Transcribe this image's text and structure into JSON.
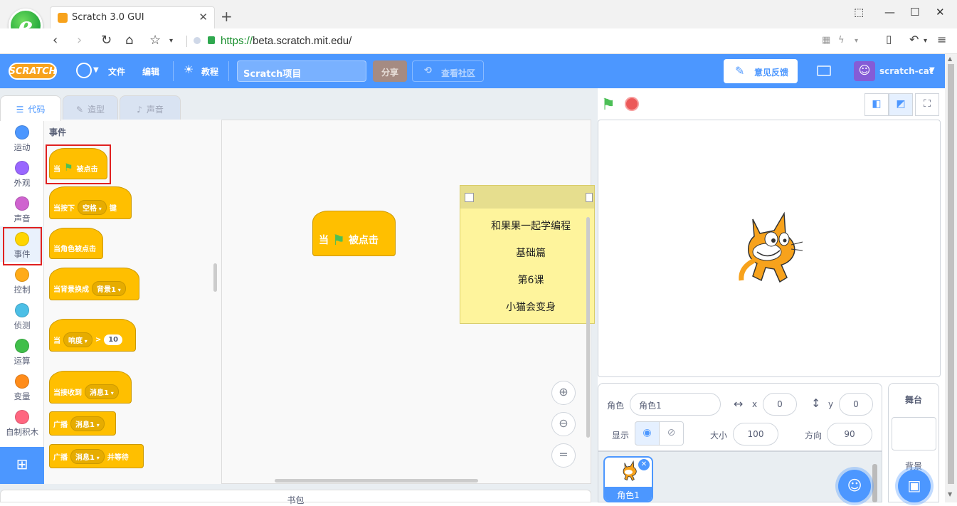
{
  "browser": {
    "tab_title": "Scratch 3.0 GUI",
    "tab_close": "✕",
    "new_tab": "+",
    "url_scheme": "https://",
    "url_host": "beta.scratch.mit.edu/",
    "window_controls": [
      "⬚",
      "—",
      "☐",
      "✕"
    ]
  },
  "menubar": {
    "logo": "SCRATCH",
    "file": "文件",
    "edit": "编辑",
    "tutorials": "教程",
    "project_title": "Scratch项目",
    "share": "分享",
    "see_community": "查看社区",
    "feedback": "意见反馈",
    "username": "scratch-cat"
  },
  "editor_tabs": {
    "code": "代码",
    "costumes": "造型",
    "sounds": "声音"
  },
  "categories": [
    {
      "label": "运动",
      "color": "#4c97ff"
    },
    {
      "label": "外观",
      "color": "#9966ff"
    },
    {
      "label": "声音",
      "color": "#cf63cf"
    },
    {
      "label": "事件",
      "color": "#ffd500"
    },
    {
      "label": "控制",
      "color": "#ffab19"
    },
    {
      "label": "侦测",
      "color": "#4cbfe6"
    },
    {
      "label": "运算",
      "color": "#40bf4a"
    },
    {
      "label": "变量",
      "color": "#ff8c1a"
    },
    {
      "label": "自制积木",
      "color": "#ff6680"
    }
  ],
  "flyout": {
    "heading": "事件",
    "blocks": {
      "when_flag_a": "当",
      "when_flag_b": "被点击",
      "when_key_a": "当按下",
      "when_key_dd": "空格",
      "when_key_b": "键",
      "when_sprite_clicked": "当角色被点击",
      "when_backdrop_a": "当背景换成",
      "when_backdrop_dd": "背景1",
      "when_gt_a": "当",
      "when_gt_dd": "响度",
      "when_gt_op": ">",
      "when_gt_val": "10",
      "when_receive_a": "当接收到",
      "when_receive_dd": "消息1",
      "broadcast_a": "广播",
      "broadcast_dd": "消息1",
      "broadcast_wait_a": "广播",
      "broadcast_wait_dd": "消息1",
      "broadcast_wait_b": "并等待"
    }
  },
  "workspace": {
    "script_a": "当",
    "script_b": "被点击",
    "note_lines": [
      "和果果一起学编程",
      "基础篇",
      "第6课",
      "小猫会变身"
    ]
  },
  "backpack": "书包",
  "sprite_info": {
    "sprite_label": "角色",
    "sprite_name": "角色1",
    "x_label": "x",
    "x_value": "0",
    "y_label": "y",
    "y_value": "0",
    "show_label": "显示",
    "size_label": "大小",
    "size_value": "100",
    "direction_label": "方向",
    "direction_value": "90"
  },
  "sprite_list": {
    "tile_name": "角色1"
  },
  "stage_panel": {
    "title": "舞台",
    "backdrop": "背景"
  },
  "colors": {
    "menubar": "#4c97ff",
    "events": "#ffbf00",
    "highlight": "#e02020"
  }
}
